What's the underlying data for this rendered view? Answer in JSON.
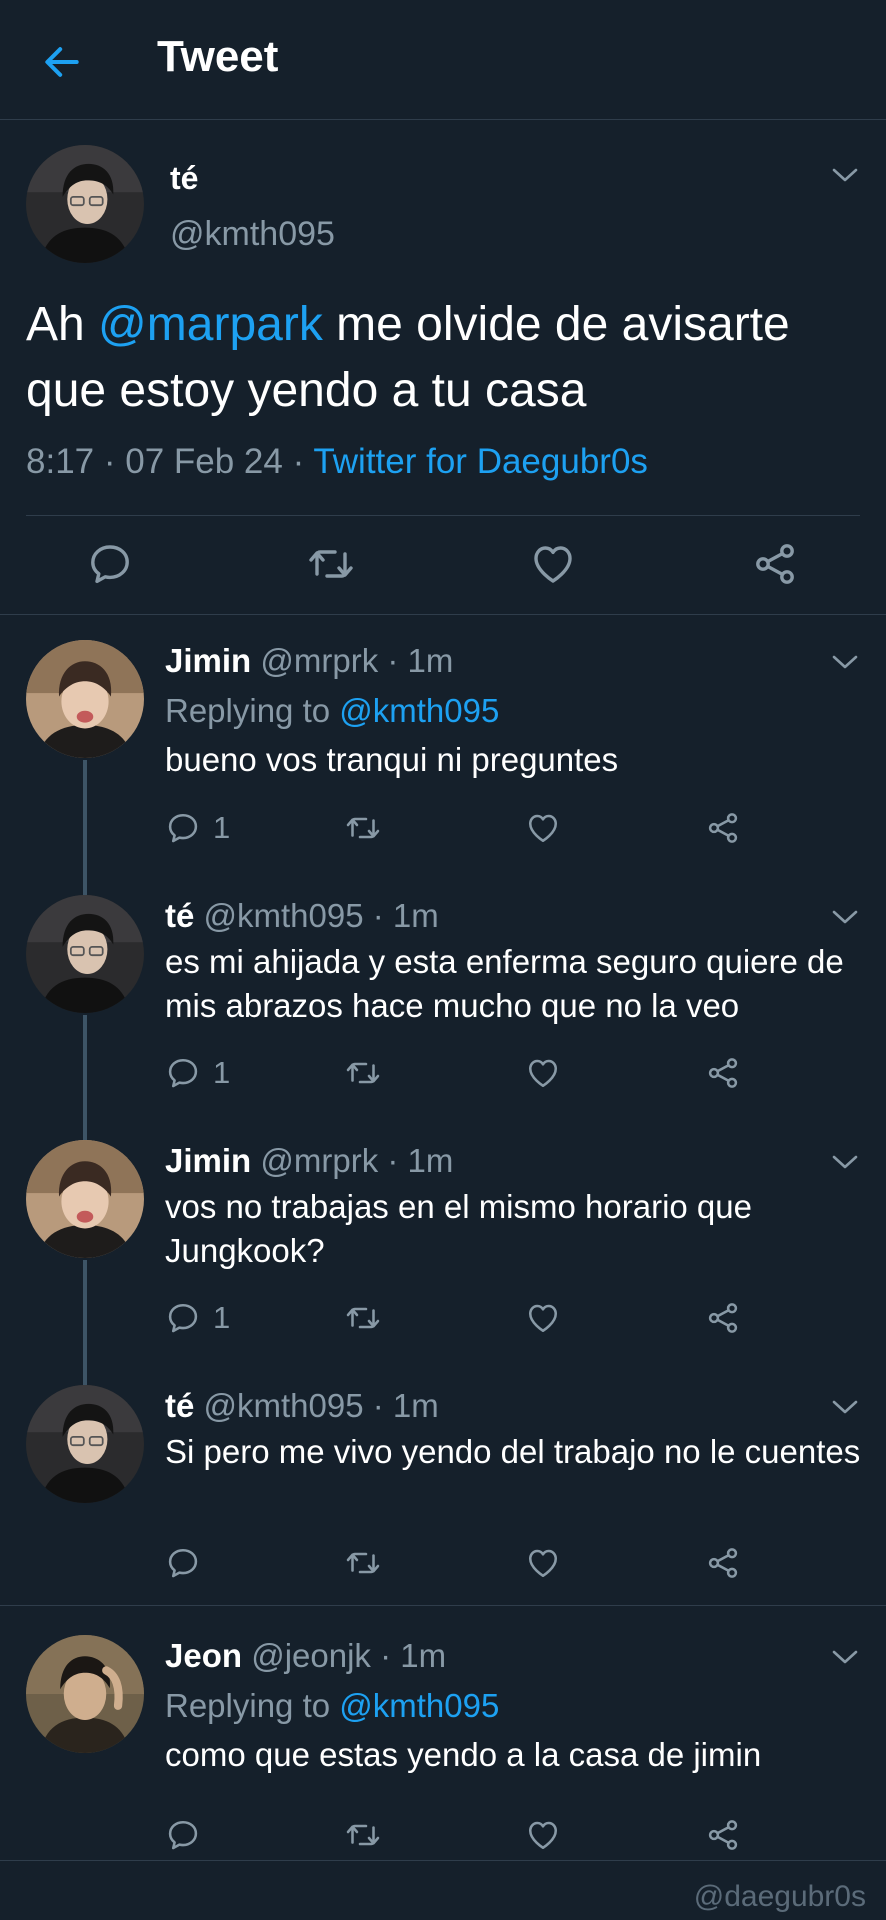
{
  "header": {
    "title": "Tweet"
  },
  "main_tweet": {
    "name": "té",
    "handle": "@kmth095",
    "text_prefix": "Ah ",
    "mention": "@marpark",
    "text_suffix": " me olvide de avisarte que estoy yendo a tu casa",
    "time": "8:17 · 07 Feb 24 · ",
    "source": "Twitter for Daegubr0s"
  },
  "replies": [
    {
      "name": "Jimin",
      "meta": " @mrprk · 1m",
      "replying_label": "Replying to ",
      "replying_to": "@kmth095",
      "text": "bueno vos tranqui ni preguntes",
      "reply_count": "1"
    },
    {
      "name": "té",
      "meta": " @kmth095 · 1m",
      "text": "es mi ahijada y esta enferma seguro quiere de mis abrazos hace mucho que no la veo",
      "reply_count": "1"
    },
    {
      "name": "Jimin",
      "meta": " @mrprk · 1m",
      "text": "vos no trabajas en el mismo horario que Jungkook?",
      "reply_count": "1"
    },
    {
      "name": "té",
      "meta": " @kmth095 · 1m",
      "text": "Si pero me vivo yendo del trabajo no le cuentes",
      "reply_count": ""
    },
    {
      "name": "Jeon",
      "meta": " @jeonjk · 1m",
      "replying_label": "Replying to ",
      "replying_to": "@kmth095",
      "text": "como que estas yendo a la casa de jimin",
      "reply_count": ""
    }
  ],
  "watermark": "@daegubr0s"
}
